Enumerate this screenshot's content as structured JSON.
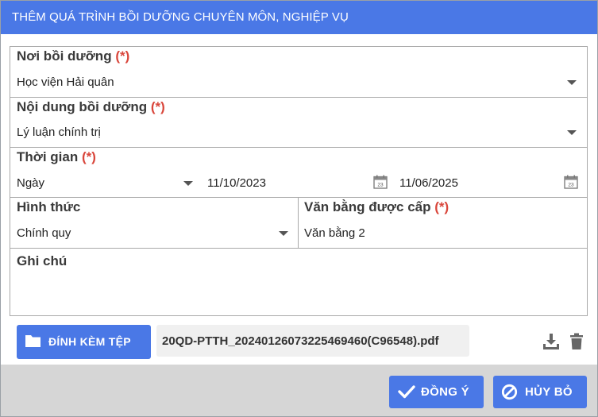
{
  "dialog": {
    "title": "THÊM QUÁ TRÌNH BỒI DƯỠNG CHUYÊN MÔN, NGHIỆP VỤ"
  },
  "required_mark": "(*)",
  "fields": {
    "noi_boi_duong": {
      "label": "Nơi bồi dưỡng",
      "value": "Học viện Hải quân"
    },
    "noi_dung": {
      "label": "Nội dung bồi dưỡng",
      "value": "Lý luận chính trị"
    },
    "thoi_gian": {
      "label": "Thời gian",
      "unit": "Ngày",
      "from": "11/10/2023",
      "to": "11/06/2025",
      "calendar_day": "23"
    },
    "hinh_thuc": {
      "label": "Hình thức",
      "value": "Chính quy"
    },
    "van_bang": {
      "label": "Văn bằng được cấp",
      "value": "Văn bằng 2"
    },
    "ghi_chu": {
      "label": "Ghi chú",
      "value": ""
    }
  },
  "attachment": {
    "button_label": "ĐÍNH KÈM TỆP",
    "file_name": "20QD-PTTH_20240126073225469460(C96548).pdf"
  },
  "footer": {
    "ok_label": "ĐỒNG Ý",
    "cancel_label": "HỦY BỎ"
  },
  "colors": {
    "primary": "#4a78e6",
    "required": "#d9463b",
    "footer_bg": "#d6d6d6"
  },
  "icons": [
    "folder-icon",
    "download-icon",
    "trash-icon",
    "calendar-icon",
    "check-icon",
    "ban-icon",
    "caret-down-icon"
  ]
}
